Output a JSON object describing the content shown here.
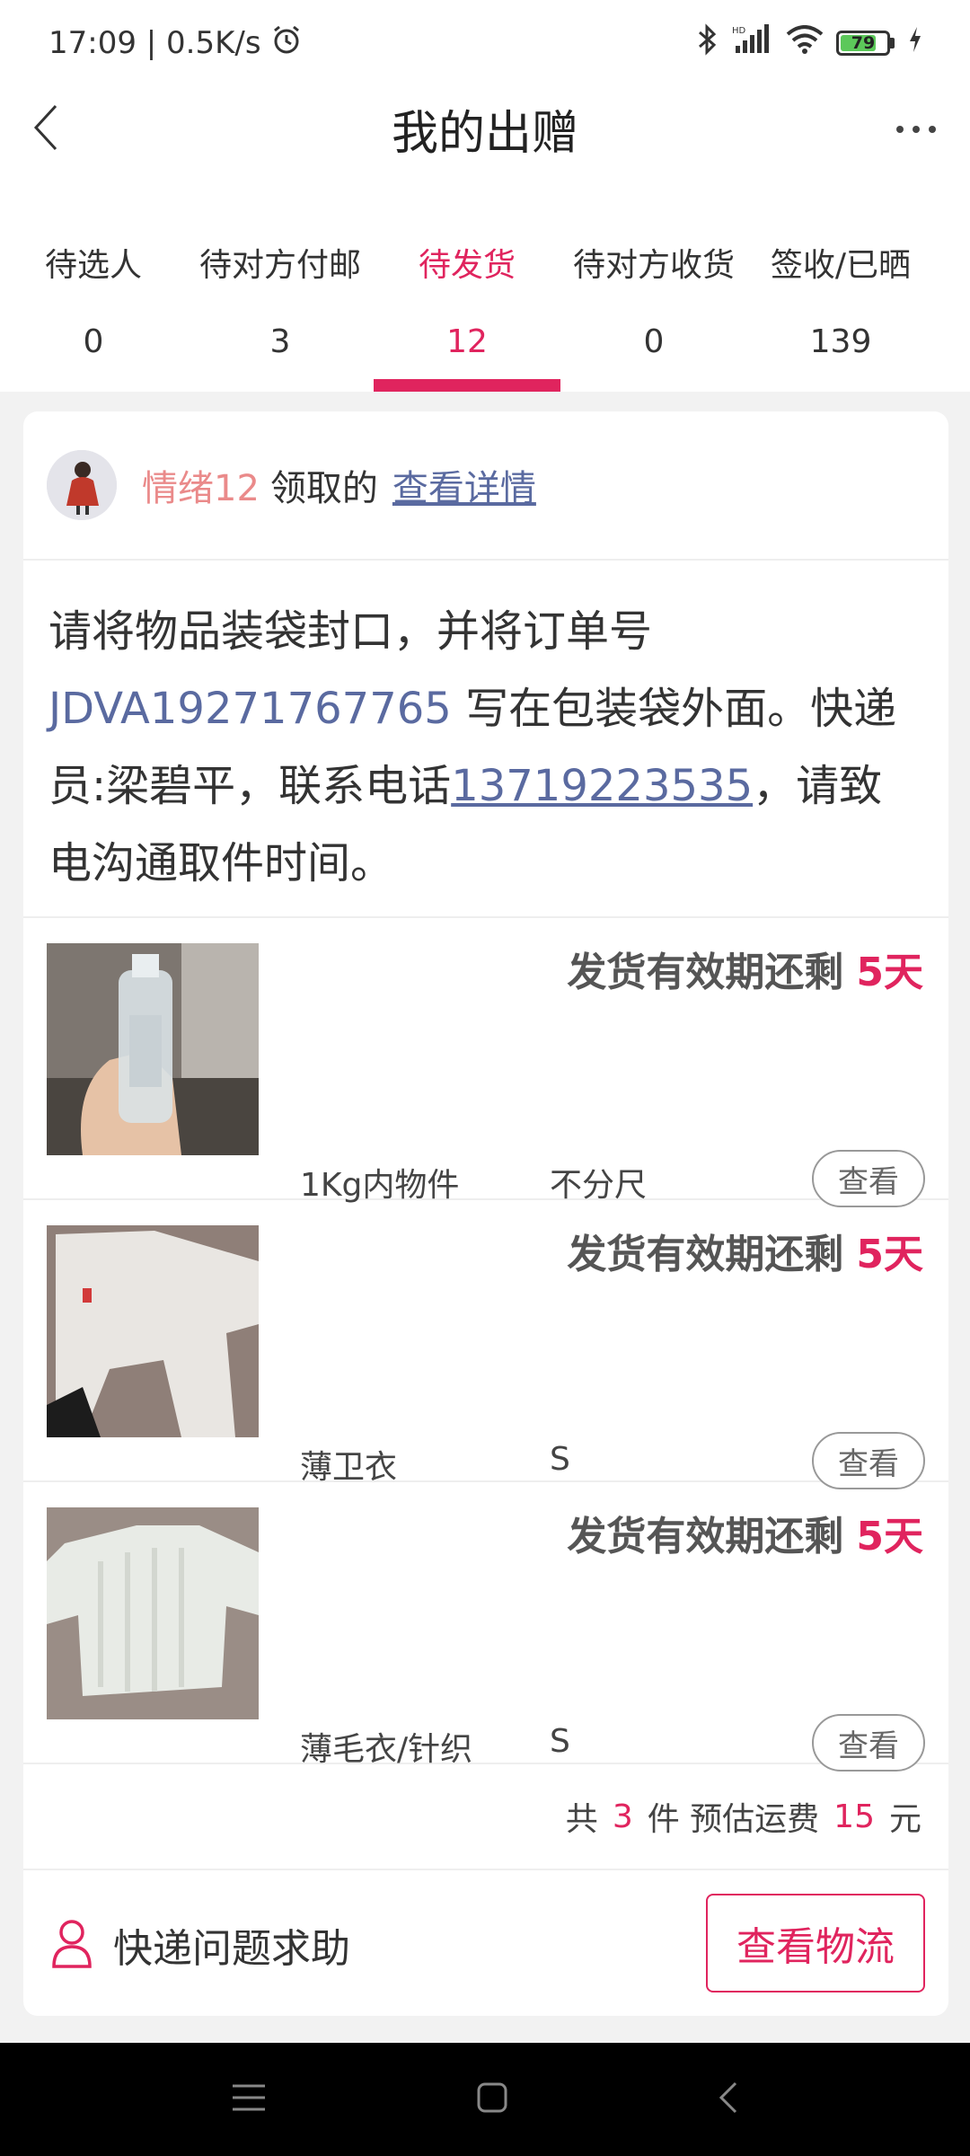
{
  "status_bar": {
    "time_speed": "17:09 | 0.5K/s",
    "battery": "79"
  },
  "header": {
    "title": "我的出赠"
  },
  "tabs": [
    {
      "label": "待选人",
      "count": "0"
    },
    {
      "label": "待对方付邮",
      "count": "3"
    },
    {
      "label": "待发货",
      "count": "12"
    },
    {
      "label": "待对方收货",
      "count": "0"
    },
    {
      "label": "签收/已晒",
      "count": "139"
    }
  ],
  "card": {
    "receiver_name": "情绪12",
    "receiver_action": "领取的",
    "details_link": "查看详情",
    "notice_prefix": "请将物品装袋封口，并将订单号 ",
    "order_number": "JDVA19271767765",
    "notice_middle": " 写在包装袋外面。快递员:梁碧平，联系电话",
    "phone": "13719223535",
    "notice_suffix": "，请致电沟通取件时间。",
    "items": [
      {
        "expire_label": "发货有效期还剩",
        "days": "5天",
        "name": "1Kg内物件",
        "size": "不分尺",
        "view_label": "查看"
      },
      {
        "expire_label": "发货有效期还剩",
        "days": "5天",
        "name": "薄卫衣",
        "size": "S",
        "view_label": "查看"
      },
      {
        "expire_label": "发货有效期还剩",
        "days": "5天",
        "name": "薄毛衣/针织",
        "size": "S",
        "view_label": "查看"
      }
    ],
    "summary": {
      "prefix": "共",
      "count": "3",
      "mid": "件 预估运费",
      "fee": "15",
      "suffix": "元"
    },
    "help_label": "快递问题求助",
    "logistics_label": "查看物流"
  },
  "colors": {
    "accent": "#e0245e",
    "link": "#5a6aa0"
  }
}
